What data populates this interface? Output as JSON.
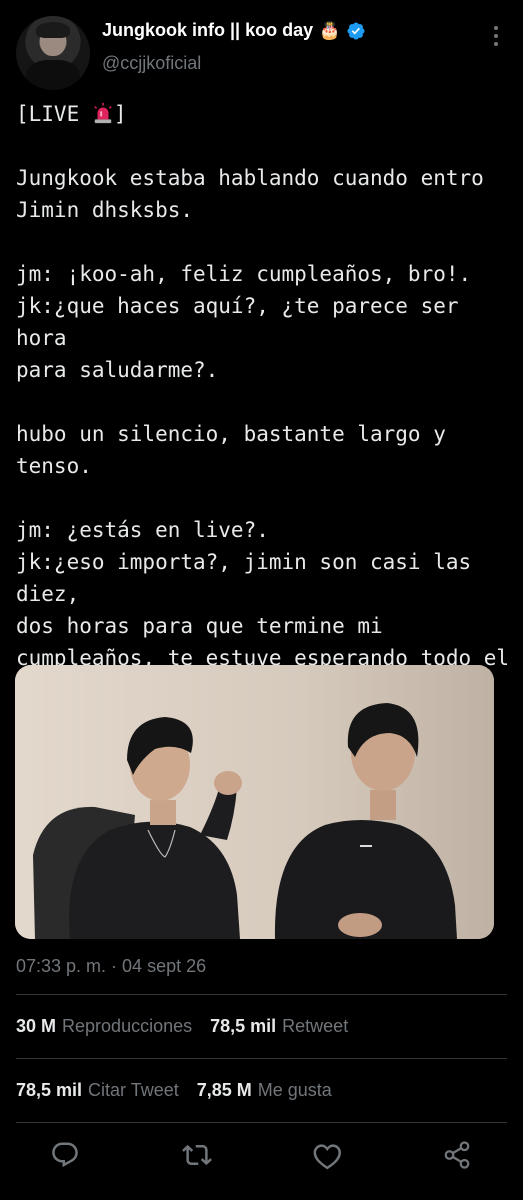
{
  "author": {
    "display_name": "Jungkook info || koo day",
    "name_emoji": "🎂",
    "handle": "@ccjjkoficial",
    "verified": true
  },
  "tweet": {
    "text": "[LIVE 🚨]\n\nJungkook estaba hablando cuando entro\nJimin dhsksbs.\n\njm: ¡koo-ah, feliz cumpleaños, bro!.\njk:¿que haces aquí?, ¿te parece ser hora\npara saludarme?.\n\nhubo un silencio, bastante largo y tenso.\n\njm: ¿estás en live?.\njk:¿eso importa?, jimin son casi las diez,\ndos horas para que termine mi\ncumpleaños, te estuve esperando todo el\ndía.\njm: apaga eso y te explico.\njk: no, dímelo, aquí y ahora.",
    "timestamp": "07:33 p. m. · 04 sept 26"
  },
  "stats": {
    "views_count": "30 M",
    "views_label": "Reproducciones",
    "retweets_count": "78,5 mil",
    "retweets_label": "Retweet",
    "quotes_count": "78,5 mil",
    "quotes_label": "Citar Tweet",
    "likes_count": "7,85 M",
    "likes_label": "Me gusta"
  },
  "actions": [
    "reply-icon",
    "retweet-icon",
    "like-icon",
    "share-icon"
  ],
  "colors": {
    "background": "#000000",
    "text": "#e7e9ea",
    "secondary": "#71767b",
    "verified": "#1d9bf0",
    "divider": "#2f3336"
  }
}
